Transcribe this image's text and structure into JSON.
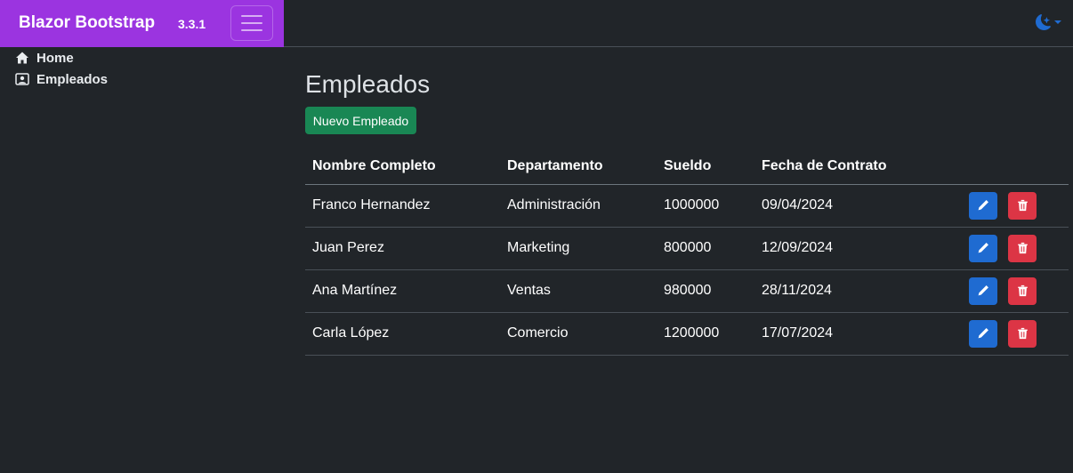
{
  "brand": {
    "title": "Blazor Bootstrap",
    "version": "3.3.1"
  },
  "sidebar": {
    "items": [
      {
        "label": "Home",
        "icon": "house-icon"
      },
      {
        "label": "Empleados",
        "icon": "person-badge-icon"
      }
    ]
  },
  "main": {
    "title": "Empleados",
    "new_button_label": "Nuevo Empleado",
    "table": {
      "headers": [
        "Nombre Completo",
        "Departamento",
        "Sueldo",
        "Fecha de Contrato"
      ],
      "rows": [
        {
          "nombre": "Franco Hernandez",
          "departamento": "Administración",
          "sueldo": "1000000",
          "fecha": "09/04/2024"
        },
        {
          "nombre": "Juan Perez",
          "departamento": "Marketing",
          "sueldo": "800000",
          "fecha": "12/09/2024"
        },
        {
          "nombre": "Ana Martínez",
          "departamento": "Ventas",
          "sueldo": "980000",
          "fecha": "28/11/2024"
        },
        {
          "nombre": "Carla López",
          "departamento": "Comercio",
          "sueldo": "1200000",
          "fecha": "17/07/2024"
        }
      ]
    }
  },
  "colors": {
    "brand": "#9b34e0",
    "success": "#198754",
    "primary": "#1f6bd1",
    "danger": "#dc3545",
    "background": "#212529"
  }
}
